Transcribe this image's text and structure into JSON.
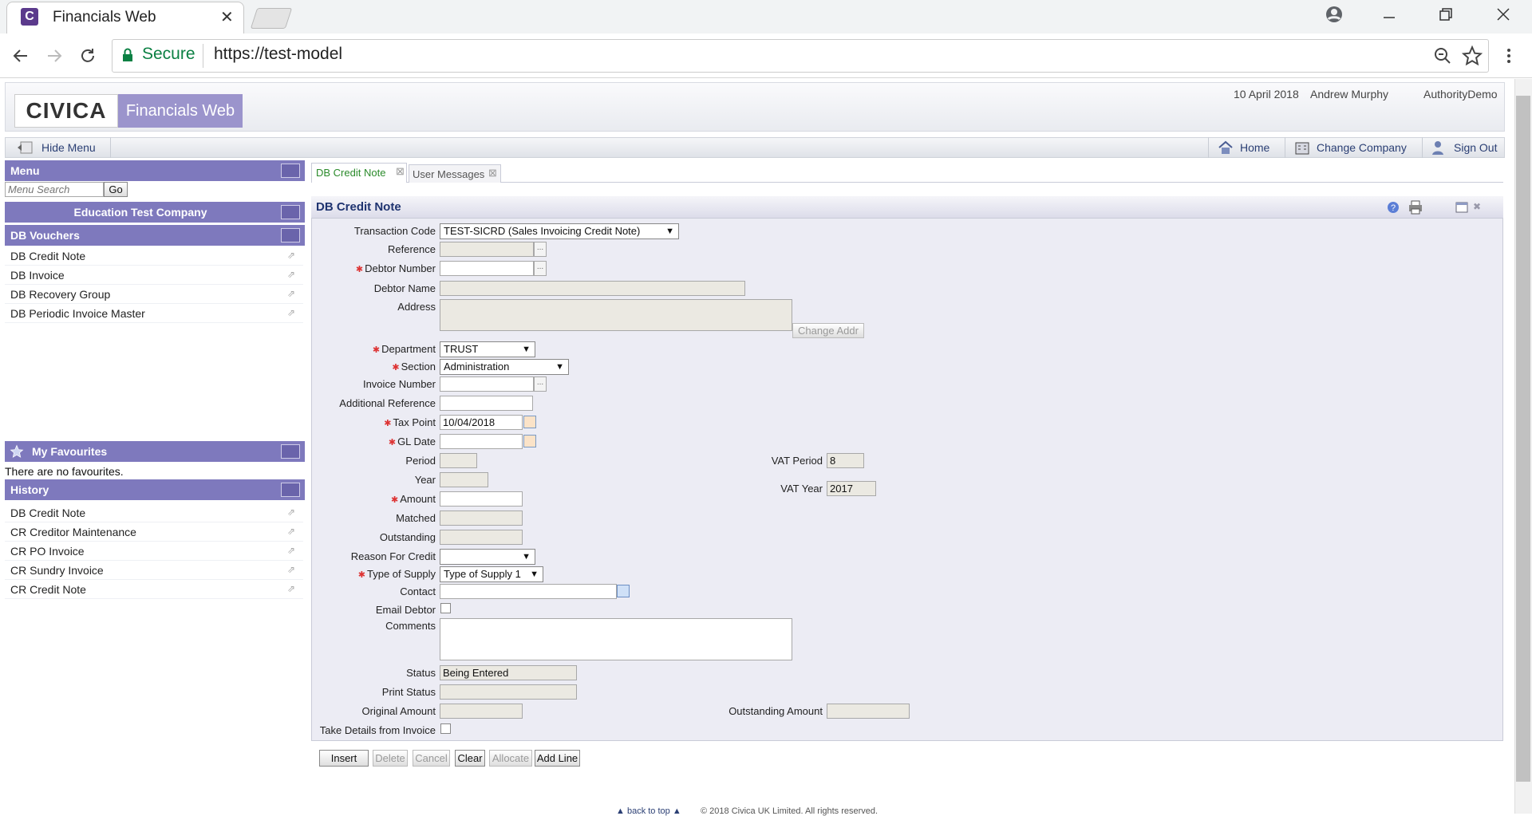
{
  "browser": {
    "tab_title": "Financials Web",
    "favicon_letter": "C",
    "secure_label": "Secure",
    "url": "https://test-model"
  },
  "header": {
    "logo_text": "CIVICA",
    "product_name": "Financials Web",
    "date": "10 April 2018",
    "user": "Andrew Murphy",
    "authority": "AuthorityDemo"
  },
  "navbar": {
    "hide_menu": "Hide Menu",
    "home": "Home",
    "change_company": "Change Company",
    "sign_out": "Sign Out"
  },
  "menu": {
    "title": "Menu",
    "search_placeholder": "Menu Search",
    "go_label": "Go",
    "company": "Education Test Company",
    "section_title": "DB Vouchers",
    "items": [
      "DB Credit Note",
      "DB Invoice",
      "DB Recovery Group",
      "DB Periodic Invoice Master"
    ]
  },
  "favourites": {
    "title": "My Favourites",
    "empty_text": "There are no favourites."
  },
  "history": {
    "title": "History",
    "items": [
      "DB Credit Note",
      "CR Creditor Maintenance",
      "CR PO Invoice",
      "CR Sundry Invoice",
      "CR Credit Note"
    ]
  },
  "tabs": [
    "DB Credit Note",
    "User Messages"
  ],
  "form": {
    "title": "DB Credit Note",
    "labels": {
      "transaction_code": "Transaction Code",
      "reference": "Reference",
      "debtor_number": "Debtor Number",
      "debtor_name": "Debtor Name",
      "address": "Address",
      "department": "Department",
      "section": "Section",
      "invoice_number": "Invoice Number",
      "additional_reference": "Additional Reference",
      "tax_point": "Tax Point",
      "gl_date": "GL Date",
      "period": "Period",
      "year": "Year",
      "amount": "Amount",
      "matched": "Matched",
      "outstanding": "Outstanding",
      "reason_for_credit": "Reason For Credit",
      "type_of_supply": "Type of Supply",
      "contact": "Contact",
      "email_debtor": "Email Debtor",
      "comments": "Comments",
      "status": "Status",
      "print_status": "Print Status",
      "original_amount": "Original Amount",
      "take_details": "Take Details from Invoice",
      "vat_period": "VAT Period",
      "vat_year": "VAT Year",
      "outstanding_amount": "Outstanding Amount"
    },
    "values": {
      "transaction_code": "TEST-SICRD (Sales Invoicing Credit Note)",
      "department": "TRUST",
      "section": "Administration",
      "tax_point": "10/04/2018",
      "type_of_supply": "Type of Supply 1",
      "status": "Being Entered",
      "vat_period": "8",
      "vat_year": "2017"
    },
    "change_addr": "Change Addr"
  },
  "actions": [
    "Insert",
    "Delete",
    "Cancel",
    "Clear",
    "Allocate",
    "Add Line"
  ],
  "footer": {
    "back_to_top": "back to top",
    "copyright": "© 2018 Civica UK Limited. All rights reserved."
  }
}
